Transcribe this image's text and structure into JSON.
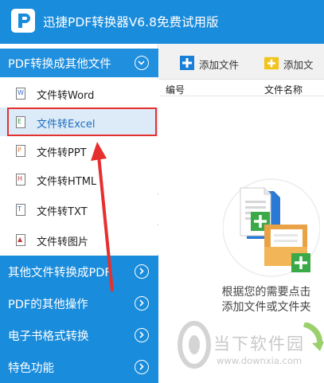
{
  "app": {
    "title": "迅捷PDF转换器V6.8免费试用版",
    "accent_color": "#1a8cdc",
    "logo_icon": "pdf-app-logo-icon"
  },
  "sidebar": {
    "sections": [
      {
        "label": "PDF转换成其他文件",
        "state": "expanded",
        "icon": "chevron-down-circle-icon"
      },
      {
        "label": "其他文件转换成PDF",
        "state": "collapsed",
        "icon": "chevron-right-circle-icon"
      },
      {
        "label": "PDF的其他操作",
        "state": "collapsed",
        "icon": "chevron-right-circle-icon"
      },
      {
        "label": "电子书格式转换",
        "state": "collapsed",
        "icon": "chevron-right-circle-icon"
      },
      {
        "label": "特色功能",
        "state": "collapsed",
        "icon": "chevron-right-circle-icon"
      }
    ],
    "items": [
      {
        "label": "文件转Word",
        "icon": "word-file-icon",
        "icon_letter": "W",
        "icon_color": "#3b6fc9"
      },
      {
        "label": "文件转Excel",
        "icon": "excel-file-icon",
        "icon_letter": "E",
        "icon_color": "#2e9e48",
        "selected": true
      },
      {
        "label": "文件转PPT",
        "icon": "ppt-file-icon",
        "icon_letter": "P",
        "icon_color": "#e0792c"
      },
      {
        "label": "文件转HTML",
        "icon": "html-file-icon",
        "icon_letter": "H",
        "icon_color": "#c23b3b"
      },
      {
        "label": "文件转TXT",
        "icon": "txt-file-icon",
        "icon_letter": "T",
        "icon_color": "#2f5fa8"
      },
      {
        "label": "文件转图片",
        "icon": "image-file-icon",
        "icon_letter": "▲",
        "icon_color": "#c23b3b"
      }
    ]
  },
  "toolbar": {
    "add_file_label": "添加文件",
    "add_folder_label": "添加文",
    "add_file_icon": "plus-blue-icon",
    "add_folder_icon": "plus-folder-icon"
  },
  "file_list": {
    "columns": [
      "编号",
      "文件名称"
    ]
  },
  "empty_state": {
    "line1": "根据您的需要点击",
    "line2": "添加文件或文件夹"
  },
  "watermark": {
    "title": "当下软件园",
    "url": "www.downxia.com"
  },
  "annotation": {
    "highlight_color": "#e5302f"
  }
}
